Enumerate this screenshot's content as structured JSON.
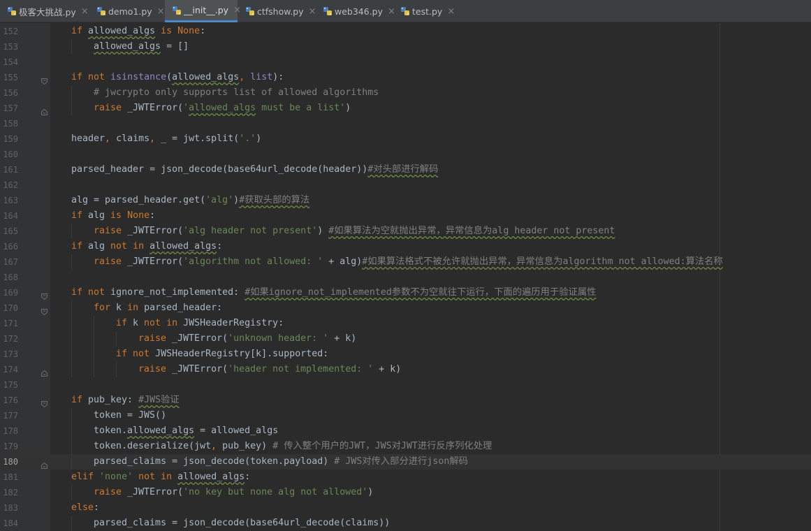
{
  "tabs": [
    {
      "label": "极客大挑战.py",
      "active": false
    },
    {
      "label": "demo1.py",
      "active": false
    },
    {
      "label": "__init__.py",
      "active": true
    },
    {
      "label": "ctfshow.py",
      "active": false
    },
    {
      "label": "web346.py",
      "active": false
    },
    {
      "label": "test.py",
      "active": false
    }
  ],
  "close_glyph": "×",
  "editor": {
    "current_line": 180,
    "lines": [
      {
        "n": "152",
        "tokens": [
          [
            "kw",
            "if"
          ],
          [
            "t",
            " allowed_algs "
          ],
          [
            "kw",
            "is"
          ],
          [
            "t",
            " "
          ],
          [
            "kw",
            "None"
          ],
          [
            "t",
            ":"
          ]
        ]
      },
      {
        "n": "153",
        "tokens": [
          [
            "t",
            "allowed_algs = []"
          ]
        ]
      },
      {
        "n": "154",
        "tokens": []
      },
      {
        "n": "155",
        "tokens": [
          [
            "kw",
            "if"
          ],
          [
            "t",
            " "
          ],
          [
            "kw",
            "not"
          ],
          [
            "t",
            " "
          ],
          [
            "bi",
            "isinstance"
          ],
          [
            "t",
            "(allowed_algs"
          ],
          [
            "kw",
            ","
          ],
          [
            "t",
            " "
          ],
          [
            "bi",
            "list"
          ],
          [
            "t",
            "):"
          ]
        ]
      },
      {
        "n": "156",
        "tokens": [
          [
            "cm",
            "# jwcrypto only supports list of allowed algorithms"
          ]
        ]
      },
      {
        "n": "157",
        "tokens": [
          [
            "kw",
            "raise"
          ],
          [
            "t",
            " _JWTError("
          ],
          [
            "str",
            "'allowed_algs must be a list'"
          ],
          [
            "t",
            ")"
          ]
        ]
      },
      {
        "n": "158",
        "tokens": []
      },
      {
        "n": "159",
        "tokens": [
          [
            "t",
            "header"
          ],
          [
            "kw",
            ","
          ],
          [
            "t",
            " claims"
          ],
          [
            "kw",
            ","
          ],
          [
            "t",
            " _ = jwt.split("
          ],
          [
            "str",
            "'.'"
          ],
          [
            "t",
            ")"
          ]
        ]
      },
      {
        "n": "160",
        "tokens": []
      },
      {
        "n": "161",
        "tokens": [
          [
            "t",
            "parsed_header = json_decode(base64url_decode(header))"
          ],
          [
            "cm",
            "#对头部进行解码"
          ]
        ]
      },
      {
        "n": "162",
        "tokens": []
      },
      {
        "n": "163",
        "tokens": [
          [
            "t",
            "alg = parsed_header.get("
          ],
          [
            "str",
            "'alg'"
          ],
          [
            "t",
            ")"
          ],
          [
            "cm",
            "#获取头部的算法"
          ]
        ]
      },
      {
        "n": "164",
        "tokens": [
          [
            "kw",
            "if"
          ],
          [
            "t",
            " alg "
          ],
          [
            "kw",
            "is"
          ],
          [
            "t",
            " "
          ],
          [
            "kw",
            "None"
          ],
          [
            "t",
            ":"
          ]
        ]
      },
      {
        "n": "165",
        "tokens": [
          [
            "kw",
            "raise"
          ],
          [
            "t",
            " _JWTError("
          ],
          [
            "str",
            "'alg header not present'"
          ],
          [
            "t",
            ") "
          ],
          [
            "cm",
            "#如果算法为空就抛出异常，异常信息为alg header not present"
          ]
        ]
      },
      {
        "n": "166",
        "tokens": [
          [
            "kw",
            "if"
          ],
          [
            "t",
            " alg "
          ],
          [
            "kw",
            "not in"
          ],
          [
            "t",
            " allowed_algs:"
          ]
        ]
      },
      {
        "n": "167",
        "tokens": [
          [
            "kw",
            "raise"
          ],
          [
            "t",
            " _JWTError("
          ],
          [
            "str",
            "'algorithm not allowed: '"
          ],
          [
            "t",
            " + alg)"
          ],
          [
            "cm",
            "#如果算法格式不被允许就抛出异常，异常信息为algorithm not allowed:算法名称"
          ]
        ]
      },
      {
        "n": "168",
        "tokens": []
      },
      {
        "n": "169",
        "tokens": [
          [
            "kw",
            "if"
          ],
          [
            "t",
            " "
          ],
          [
            "kw",
            "not"
          ],
          [
            "t",
            " ignore_not_implemented: "
          ],
          [
            "cm",
            "#如果ignore_not_implemented参数不为空就往下运行，下面的遍历用于验证属性"
          ]
        ]
      },
      {
        "n": "170",
        "tokens": [
          [
            "kw",
            "for"
          ],
          [
            "t",
            " k "
          ],
          [
            "kw",
            "in"
          ],
          [
            "t",
            " parsed_header:"
          ]
        ]
      },
      {
        "n": "171",
        "tokens": [
          [
            "kw",
            "if"
          ],
          [
            "t",
            " k "
          ],
          [
            "kw",
            "not in"
          ],
          [
            "t",
            " JWSHeaderRegistry:"
          ]
        ]
      },
      {
        "n": "172",
        "tokens": [
          [
            "kw",
            "raise"
          ],
          [
            "t",
            " _JWTError("
          ],
          [
            "str",
            "'unknown header: '"
          ],
          [
            "t",
            " + k)"
          ]
        ]
      },
      {
        "n": "173",
        "tokens": [
          [
            "kw",
            "if"
          ],
          [
            "t",
            " "
          ],
          [
            "kw",
            "not"
          ],
          [
            "t",
            " JWSHeaderRegistry[k].supported:"
          ]
        ]
      },
      {
        "n": "174",
        "tokens": [
          [
            "kw",
            "raise"
          ],
          [
            "t",
            " _JWTError("
          ],
          [
            "str",
            "'header not implemented: '"
          ],
          [
            "t",
            " + k)"
          ]
        ]
      },
      {
        "n": "175",
        "tokens": []
      },
      {
        "n": "176",
        "tokens": [
          [
            "kw",
            "if"
          ],
          [
            "t",
            " pub_key: "
          ],
          [
            "cm",
            "#JWS验证"
          ]
        ]
      },
      {
        "n": "177",
        "tokens": [
          [
            "t",
            "token = JWS()"
          ]
        ]
      },
      {
        "n": "178",
        "tokens": [
          [
            "t",
            "token.allowed_algs = allowed_algs"
          ]
        ]
      },
      {
        "n": "179",
        "tokens": [
          [
            "t",
            "token.deserialize(jwt"
          ],
          [
            "kw",
            ","
          ],
          [
            "t",
            " pub_key) "
          ],
          [
            "cm",
            "# 传入整个用户的JWT，JWS对JWT进行反序列化处理"
          ]
        ]
      },
      {
        "n": "180",
        "tokens": [
          [
            "t",
            "parsed_claims = json_decode(token.payload) "
          ],
          [
            "cm",
            "# JWS对传入部分进行json解码"
          ]
        ]
      },
      {
        "n": "181",
        "tokens": [
          [
            "kw",
            "elif"
          ],
          [
            "t",
            " "
          ],
          [
            "str",
            "'none'"
          ],
          [
            "t",
            " "
          ],
          [
            "kw",
            "not in"
          ],
          [
            "t",
            " allowed_algs:"
          ]
        ]
      },
      {
        "n": "182",
        "tokens": [
          [
            "kw",
            "raise"
          ],
          [
            "t",
            " _JWTError("
          ],
          [
            "str",
            "'no key but none alg not allowed'"
          ],
          [
            "t",
            ")"
          ]
        ]
      },
      {
        "n": "183",
        "tokens": [
          [
            "kw",
            "else"
          ],
          [
            "t",
            ":"
          ]
        ]
      },
      {
        "n": "184",
        "tokens": [
          [
            "t",
            "parsed_claims = json_decode(base64url_decode(claims))"
          ]
        ]
      }
    ]
  }
}
